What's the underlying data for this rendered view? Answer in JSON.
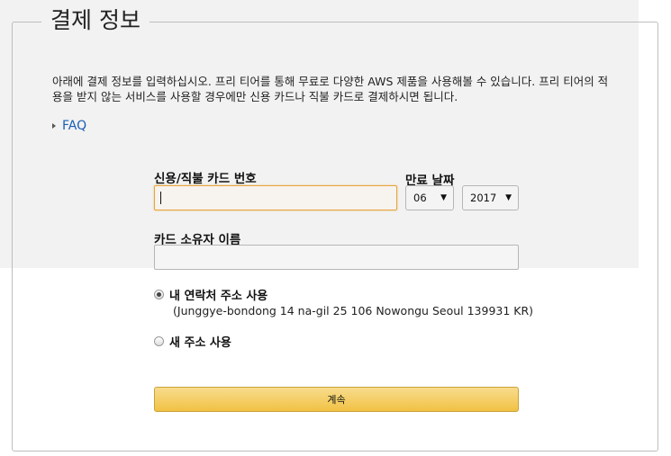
{
  "section": {
    "title": "결제 정보",
    "intro": "아래에 결제 정보를 입력하십시오. 프리 티어를 통해 무료로 다양한 AWS 제품을 사용해볼 수 있습니다. 프리 티어의 적용을 받지 않는 서비스를 사용할 경우에만 신용 카드나 직불 카드로 결제하시면 됩니다.",
    "faq_label": "FAQ"
  },
  "form": {
    "card_number": {
      "label": "신용/직불 카드 번호",
      "value": ""
    },
    "expiry": {
      "label": "만료 날짜",
      "month": "06",
      "year": "2017"
    },
    "cardholder": {
      "label": "카드 소유자 이름",
      "value": ""
    },
    "address_options": [
      {
        "label": "내 연락처 주소 사용",
        "selected": true,
        "detail": "(Junggye-bondong 14 na-gil 25 106 Nowongu Seoul 139931 KR)"
      },
      {
        "label": "새 주소 사용",
        "selected": false
      }
    ],
    "continue_label": "계속"
  },
  "colors": {
    "link": "#1a5fb4",
    "focus_border": "#e7a53c",
    "button_top": "#f8dc8d",
    "button_bottom": "#f1c143"
  }
}
